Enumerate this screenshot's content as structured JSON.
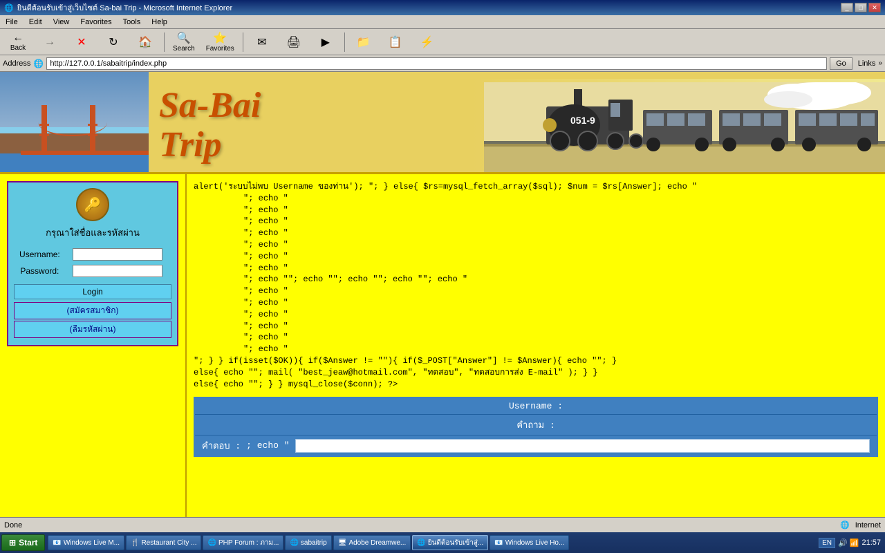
{
  "window": {
    "title": "ยินดีต้อนรับเข้าสู่เว็บไซต์ Sa-bai Trip - Microsoft Internet Explorer",
    "controls": [
      "minimize",
      "maximize",
      "close"
    ]
  },
  "menubar": {
    "items": [
      "File",
      "Edit",
      "View",
      "Favorites",
      "Tools",
      "Help"
    ]
  },
  "toolbar": {
    "back_label": "Back",
    "forward_label": "",
    "stop_label": "",
    "refresh_label": "",
    "home_label": "",
    "search_label": "Search",
    "favorites_label": "Favorites",
    "media_label": "",
    "history_label": "",
    "mail_label": "",
    "print_label": ""
  },
  "address": {
    "label": "Address",
    "url": "http://127.0.0.1/sabaitrip/index.php",
    "go_label": "Go",
    "links_label": "Links",
    "arrow": "»"
  },
  "banner": {
    "title_line1": "Sa-Bai",
    "title_line2": "Trip"
  },
  "login": {
    "icon": "🔑",
    "title": "กรุณาใส่ชื่อและรหัสผ่าน",
    "username_label": "Username:",
    "password_label": "Password:",
    "username_value": "",
    "password_value": "",
    "login_btn": "Login",
    "register_link": "(สมัครสมาชิก)",
    "forgot_link": "(ลืมรหัสผ่าน)"
  },
  "code_content": {
    "line1": "alert('ระบบไม่พบ Username ของท่าน'); \"; } else{ $rs=mysql_fetch_array($sql); $num = $rs[Answer]; echo \"",
    "line2": "\"; echo \"",
    "lines": [
      "          \"; echo \"",
      "          \"; echo \"",
      "          \"; echo \"",
      "          \"; echo \"",
      "          \"; echo \"",
      "          \"; echo \""
    ],
    "line_echo1": "          \"; echo \"\"; echo \"\"; echo \"\"; echo \"\"; echo \"",
    "line_echo2": "          \"; echo \"",
    "line_echo3": "          \"; echo \"",
    "line_echo4": "          \"; echo \"",
    "line_echo5": "          \"; echo \"",
    "line_echo6": "          \"; echo \"",
    "line_echo7": "          \"; echo \"",
    "line_ok": "          \"; } } if(isset($OK)){ if($Answer != \"\"){ if($_POST[\"Answer\"] != $Answer){ echo \"\"; }",
    "line_else1": "          else{ echo \"\"; mail( \"best_jeaw@hotmail.com\", \"ทดสอบ\", \"ทดสอบการส่ง E-mail\" ); } }",
    "line_else2": "          else{ echo \"\"; } } mysql_close($conn); ?>"
  },
  "bottom_form": {
    "username_row": "Username :",
    "question_row": "คำถาม :",
    "answer_row": "คำตอบ :",
    "echo_text": "; echo \""
  },
  "status_bar": {
    "done_label": "Done",
    "internet_label": "Internet"
  },
  "taskbar": {
    "start_label": "Start",
    "time": "21:57",
    "language": "EN",
    "items": [
      {
        "label": "Windows Live M...",
        "icon": "📧",
        "active": false
      },
      {
        "label": "Restaurant City ...",
        "icon": "🍴",
        "active": false
      },
      {
        "label": "PHP Forum : ภาม...",
        "icon": "🌐",
        "active": false
      },
      {
        "label": "sabaitrip",
        "icon": "🌐",
        "active": false
      },
      {
        "label": "Adobe Dreamwe...",
        "icon": "🖥",
        "active": false
      },
      {
        "label": "ยินดีต้อนรับเข้าสู่...",
        "icon": "🌐",
        "active": true
      },
      {
        "label": "Windows Live Ho...",
        "icon": "📧",
        "active": false
      }
    ]
  }
}
